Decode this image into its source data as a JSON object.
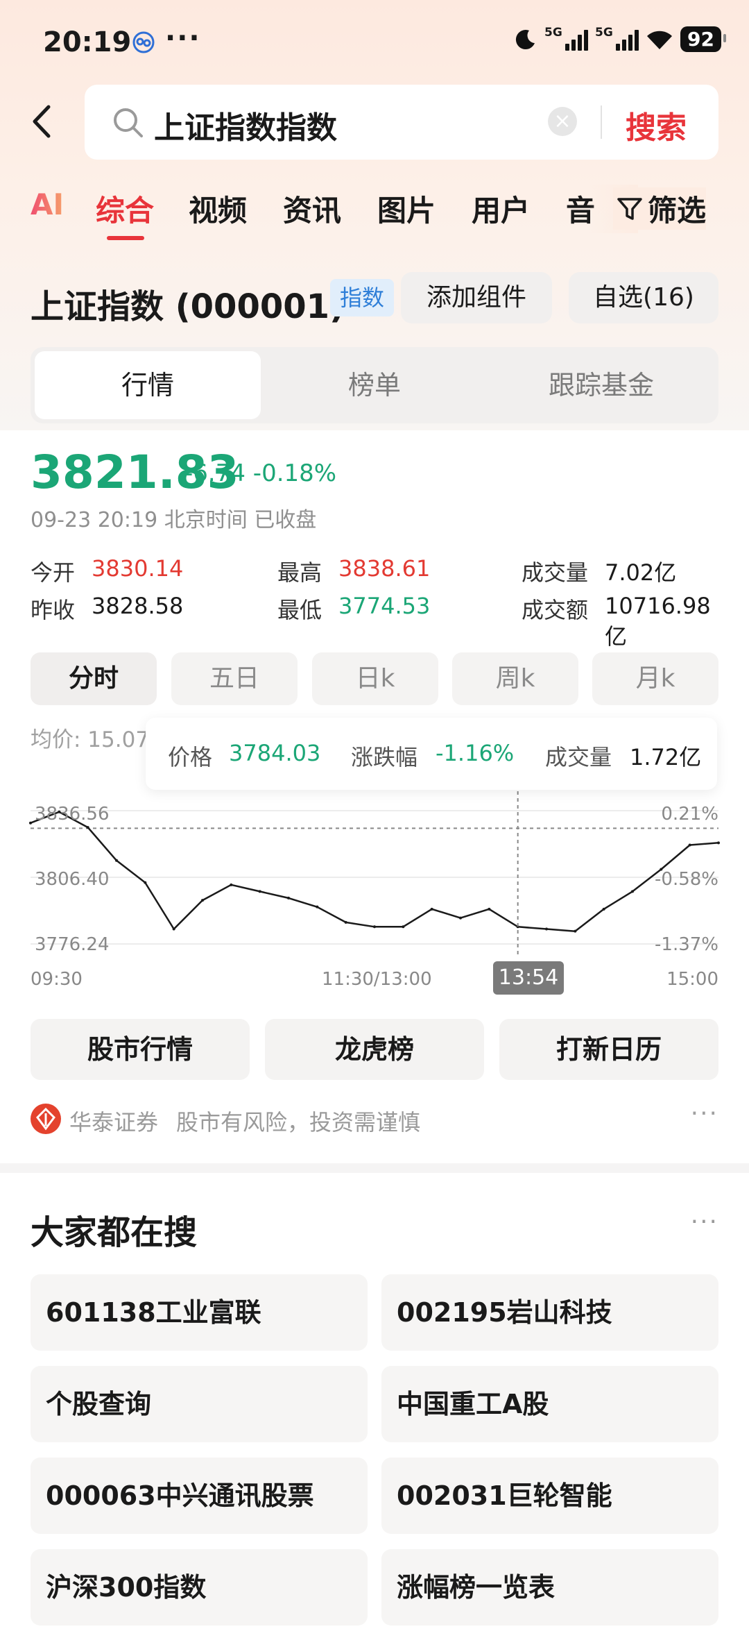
{
  "status_bar": {
    "time": "20:19",
    "dots": "···",
    "signal1_tag": "5G",
    "signal2_tag": "5G",
    "battery": "92"
  },
  "search": {
    "query": "上证指数指数",
    "submit_label": "搜索"
  },
  "tabs": {
    "ai_label": "AI",
    "items": [
      "综合",
      "视频",
      "资讯",
      "图片",
      "用户",
      "音"
    ],
    "active_index": 0,
    "filter_label": "筛选"
  },
  "index": {
    "title": "上证指数 (000001)",
    "badge": "指数",
    "add_widget_label": "添加组件",
    "watchlist_label": "自选(16)"
  },
  "segments": {
    "items": [
      "行情",
      "榜单",
      "跟踪基金"
    ],
    "active_index": 0
  },
  "quote": {
    "price": "3821.83",
    "change": "-6.74",
    "change_pct": "-0.18%",
    "timestamp": "09-23 20:19 北京时间 已收盘",
    "open_label": "今开",
    "open": "3830.14",
    "high_label": "最高",
    "high": "3838.61",
    "volume_label": "成交量",
    "volume": "7.02亿",
    "prev_close_label": "昨收",
    "prev_close": "3828.58",
    "low_label": "最低",
    "low": "3774.53",
    "turnover_label": "成交额",
    "turnover": "10716.98亿"
  },
  "periods": {
    "items": [
      "分时",
      "五日",
      "日k",
      "周k",
      "月k"
    ],
    "active_index": 0
  },
  "chart": {
    "avg_label": "均价: 15.07",
    "tooltip": {
      "price_label": "价格",
      "price": "3784.03",
      "pct_label": "涨跌幅",
      "pct": "-1.16%",
      "vol_label": "成交量",
      "vol": "1.72亿"
    },
    "y_left": [
      "3836.56",
      "3806.40",
      "3776.24"
    ],
    "y_right": [
      "0.21%",
      "-0.58%",
      "-1.37%"
    ],
    "x_labels": [
      "09:30",
      "11:30/13:00",
      "15:00"
    ],
    "cursor_time": "13:54",
    "colors": {
      "line": "#1a1a1a",
      "up": "#e33a32",
      "down": "#1ba676"
    }
  },
  "chart_data": {
    "type": "line",
    "title": "",
    "xlabel": "",
    "ylabel": "",
    "ylim": [
      3776.24,
      3836.56
    ],
    "x": [
      "09:30",
      "09:40",
      "09:50",
      "10:00",
      "10:10",
      "10:20",
      "10:30",
      "10:40",
      "10:50",
      "11:00",
      "11:10",
      "11:20",
      "11:30/13:00",
      "13:10",
      "13:20",
      "13:30",
      "13:40",
      "13:54",
      "14:00",
      "14:10",
      "14:20",
      "14:30",
      "14:40",
      "14:50",
      "15:00"
    ],
    "series": [
      {
        "values": [
          3831,
          3836,
          3829,
          3814,
          3804,
          3783,
          3796,
          3803,
          3800,
          3797,
          3793,
          3786,
          3784,
          3784,
          3792,
          3788,
          3792,
          3784,
          3783,
          3782,
          3792,
          3800,
          3810,
          3821,
          3822
        ]
      }
    ]
  },
  "actions": {
    "items": [
      "股市行情",
      "龙虎榜",
      "打新日历"
    ]
  },
  "broker": {
    "name": "华泰证券",
    "warning": "股市有风险，投资需谨慎",
    "more": "···"
  },
  "popular": {
    "title": "大家都在搜",
    "more": "···",
    "items": [
      "601138工业富联",
      "002195岩山科技",
      "个股查询",
      "中国重工A股",
      "000063中兴通讯股票",
      "002031巨轮智能",
      "沪深300指数",
      "涨幅榜一览表"
    ]
  }
}
